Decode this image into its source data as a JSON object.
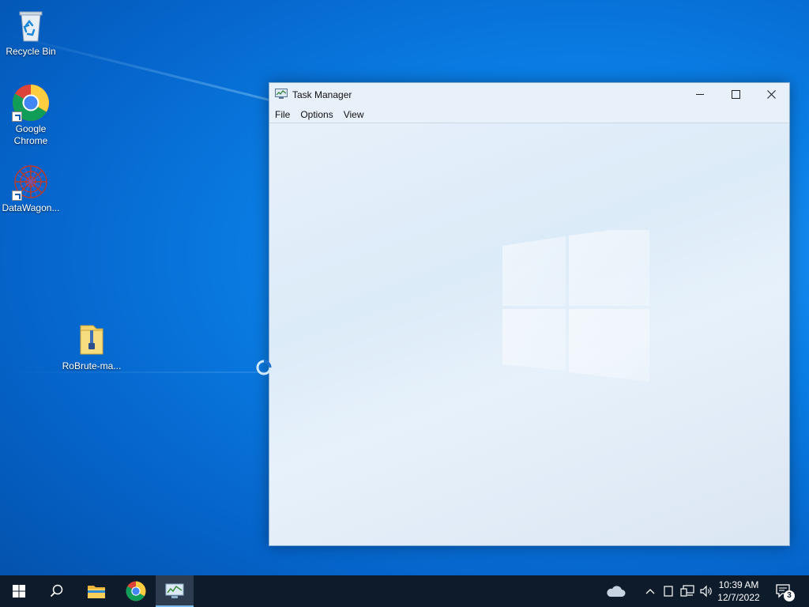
{
  "desktop": {
    "icons": [
      {
        "label": "Recycle Bin"
      },
      {
        "label": "Google Chrome"
      },
      {
        "label": "DataWagon..."
      },
      {
        "label": "RoBrute-ma..."
      }
    ]
  },
  "window": {
    "title": "Task Manager",
    "menu": [
      "File",
      "Options",
      "View"
    ]
  },
  "taskbar": {
    "items": [
      "start-icon",
      "search-icon",
      "file-explorer-icon",
      "chrome-icon",
      "task-manager-icon"
    ],
    "tray": {
      "time": "10:39 AM",
      "date": "12/7/2022",
      "notification_count": "3"
    }
  },
  "colors": {
    "desktop_bg": "#0a7fe6",
    "taskbar_bg": "#0d1b2a",
    "window_bg": "#e9f1fb",
    "accent": "#76b9ed"
  }
}
